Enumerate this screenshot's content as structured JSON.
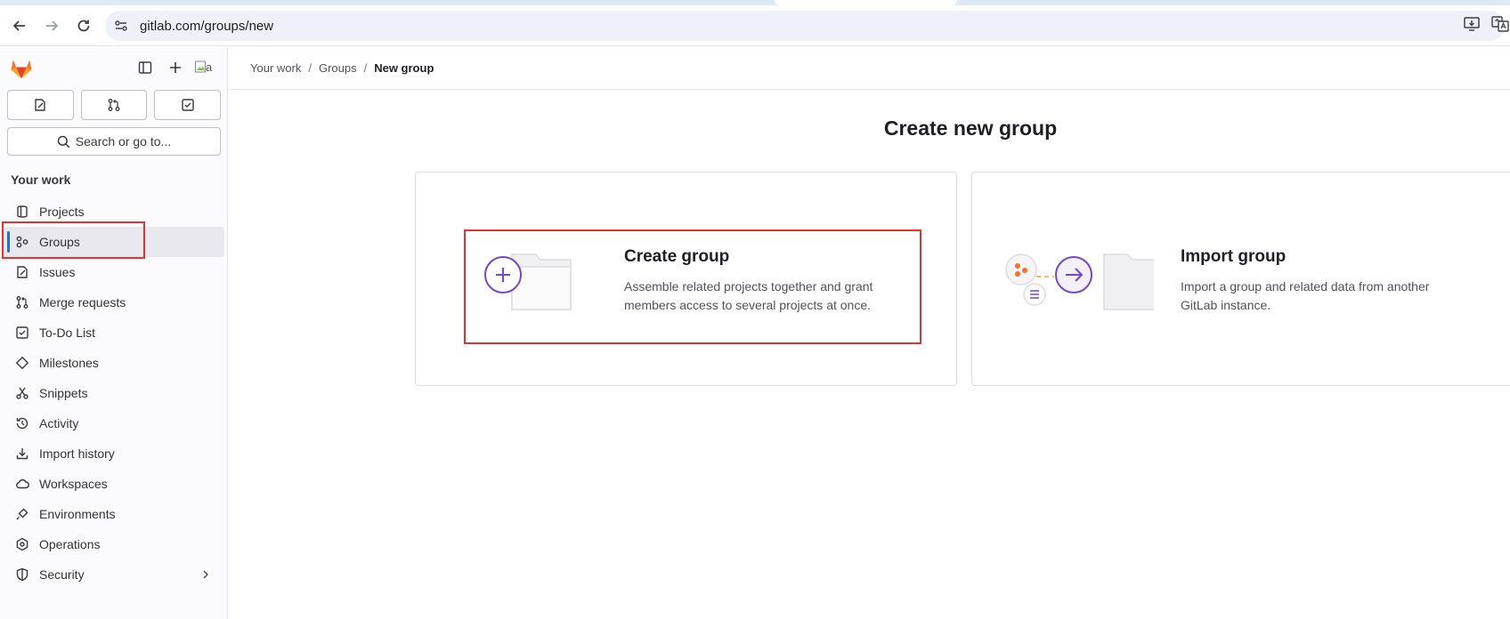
{
  "browser": {
    "url": "gitlab.com/groups/new"
  },
  "sidebar": {
    "avatar_alt": "a",
    "search_label": "Search or go to...",
    "section_title": "Your work",
    "items": [
      {
        "label": "Projects",
        "icon": "project-icon"
      },
      {
        "label": "Groups",
        "icon": "group-icon",
        "active": true
      },
      {
        "label": "Issues",
        "icon": "issues-icon"
      },
      {
        "label": "Merge requests",
        "icon": "merge-request-icon"
      },
      {
        "label": "To-Do List",
        "icon": "todo-icon"
      },
      {
        "label": "Milestones",
        "icon": "milestone-icon"
      },
      {
        "label": "Snippets",
        "icon": "snippet-icon"
      },
      {
        "label": "Activity",
        "icon": "history-icon"
      },
      {
        "label": "Import history",
        "icon": "import-icon"
      },
      {
        "label": "Workspaces",
        "icon": "workspace-icon"
      },
      {
        "label": "Environments",
        "icon": "environment-icon"
      },
      {
        "label": "Operations",
        "icon": "operations-icon"
      },
      {
        "label": "Security",
        "icon": "shield-icon"
      }
    ]
  },
  "breadcrumb": {
    "items": [
      "Your work",
      "Groups",
      "New group"
    ],
    "separator": "/"
  },
  "main": {
    "title": "Create new group",
    "cards": [
      {
        "title": "Create group",
        "description": "Assemble related projects together and grant members access to several projects at once."
      },
      {
        "title": "Import group",
        "description": "Import a group and related data from another GitLab instance."
      }
    ]
  },
  "colors": {
    "accent": "#6e49cb",
    "highlight": "#e8302e",
    "active_indicator": "#1f75cb"
  }
}
